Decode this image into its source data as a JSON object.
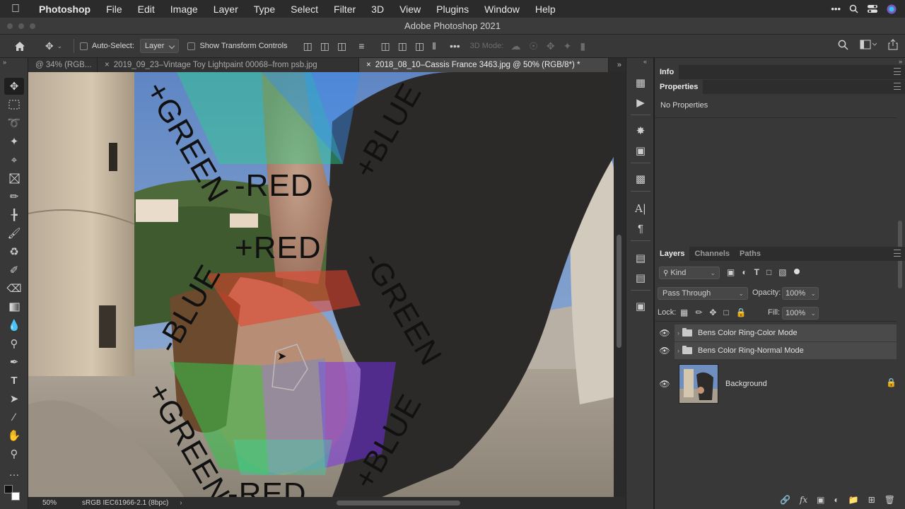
{
  "menubar": {
    "app_name": "Photoshop",
    "items": [
      "File",
      "Edit",
      "Image",
      "Layer",
      "Type",
      "Select",
      "Filter",
      "3D",
      "View",
      "Plugins",
      "Window",
      "Help"
    ]
  },
  "window": {
    "title": "Adobe Photoshop 2021"
  },
  "options_bar": {
    "auto_select_label": "Auto-Select:",
    "auto_select_value": "Layer",
    "show_transform_label": "Show Transform Controls",
    "mode_3d_label": "3D Mode:"
  },
  "tabs": [
    {
      "label": "@ 34% (RGB...",
      "active": false
    },
    {
      "label": "2019_09_23–Vintage Toy Lightpaint 00068–from psb.jpg",
      "active": false
    },
    {
      "label": "2018_08_10–Cassis France 3463.jpg @ 50% (RGB/8*) *",
      "active": true
    }
  ],
  "canvas": {
    "overlay_labels": [
      "+GREEN",
      "+BLUE",
      "-RED",
      "+RED",
      "-BLUE",
      "-GREEN",
      "+GREEN",
      "+BLUE",
      "-RED"
    ]
  },
  "status_bar": {
    "zoom": "50%",
    "profile": "sRGB IEC61966-2.1 (8bpc)"
  },
  "info_panel": {
    "tab": "Info"
  },
  "properties_panel": {
    "tab": "Properties",
    "body": "No Properties"
  },
  "layers_panel": {
    "tabs": [
      "Layers",
      "Channels",
      "Paths"
    ],
    "filter_kind": "Kind",
    "blend_mode": "Pass Through",
    "opacity_label": "Opacity:",
    "opacity_value": "100%",
    "lock_label": "Lock:",
    "fill_label": "Fill:",
    "fill_value": "100%",
    "layers": [
      {
        "name": "Bens Color Ring-Color Mode",
        "type": "group",
        "visible": true
      },
      {
        "name": "Bens Color Ring-Normal Mode",
        "type": "group",
        "visible": true
      },
      {
        "name": "Background",
        "type": "image",
        "visible": true,
        "locked": true
      }
    ]
  },
  "colors": {
    "panel_bg": "#383838",
    "app_bg": "#1e1e1e",
    "highlight_row": "#4a4a4a"
  }
}
